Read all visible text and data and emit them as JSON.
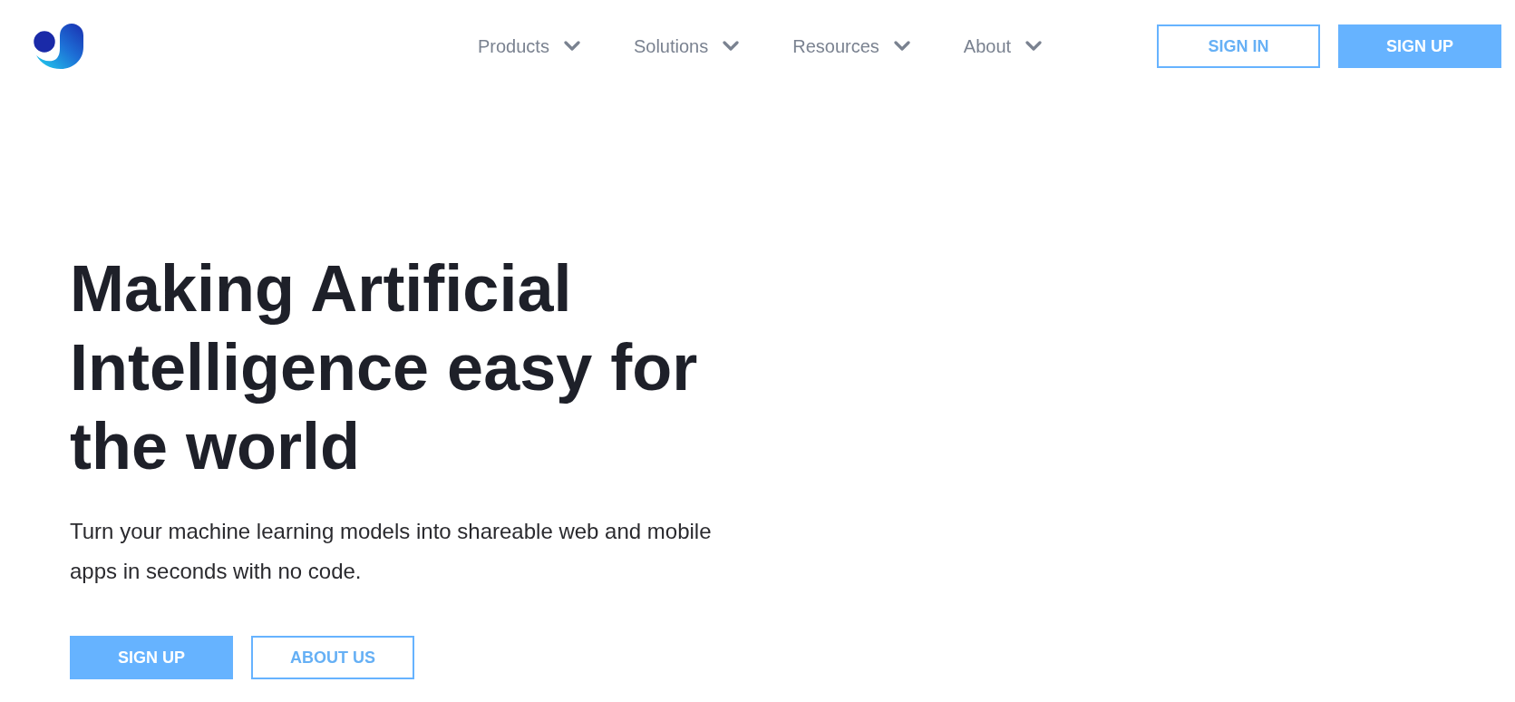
{
  "header": {
    "nav": [
      {
        "label": "Products"
      },
      {
        "label": "Solutions"
      },
      {
        "label": "Resources"
      },
      {
        "label": "About"
      }
    ],
    "buttons": [
      {
        "label": "SIGN IN",
        "kind": "outline"
      },
      {
        "label": "SIGN UP",
        "kind": "filled"
      }
    ]
  },
  "hero": {
    "heading": "Making Artificial Intelligence easy for the world",
    "subheading": "Turn your machine learning models into shareable web and mobile apps in seconds with no code.",
    "buttons": [
      {
        "label": "SIGN UP",
        "kind": "filled"
      },
      {
        "label": "ABOUT US",
        "kind": "outline"
      }
    ]
  }
}
